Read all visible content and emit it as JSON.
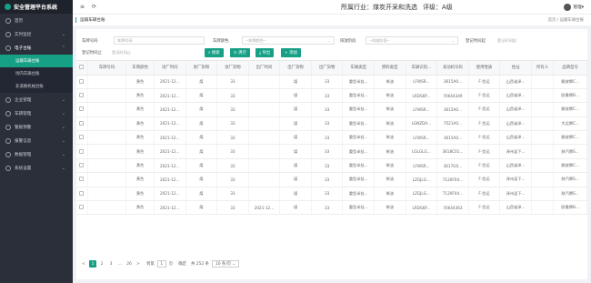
{
  "app": {
    "title": "安全管理平台系统"
  },
  "header": {
    "menu_icon": "≡",
    "refresh_icon": "⟳",
    "industry": "所属行业：煤炭开采和洗选",
    "level": "评级：A级",
    "user": "管理▾"
  },
  "sidebar": {
    "items": [
      {
        "label": "首页",
        "icon": "home-icon"
      },
      {
        "label": "实时监控",
        "icon": "monitor-icon"
      },
      {
        "label": "电子台账",
        "icon": "ledger-icon"
      },
      {
        "sub": [
          "运输车辆台账",
          "场内车辆台账",
          "非道路机械台账"
        ]
      },
      {
        "label": "企业管理",
        "icon": "company-icon"
      },
      {
        "label": "车辆管理",
        "icon": "car-icon"
      },
      {
        "label": "警报预警",
        "icon": "alarm-icon"
      },
      {
        "label": "报警信息",
        "icon": "bell-icon"
      },
      {
        "label": "数据管理",
        "icon": "data-icon"
      },
      {
        "label": "系统设置",
        "icon": "settings-icon"
      }
    ]
  },
  "tabbar": {
    "tab": "运输车辆台账",
    "crumb": "首页  /  运输车辆台账"
  },
  "filters": {
    "plate_label": "车牌号码",
    "plate_placeholder": "车牌号码",
    "color_label": "车牌颜色",
    "color_placeholder": "--车牌颜色--",
    "emission_label": "排放阶段",
    "emission_placeholder": "--排放阶段--",
    "start_label": "登记时间起",
    "start_placeholder": "登记时间起",
    "end_label": "登记时间止",
    "end_placeholder": "登记时间止"
  },
  "buttons": {
    "search": "搜索",
    "reset": "清空",
    "export": "导出",
    "add": "添加"
  },
  "table": {
    "headers": [
      "车牌号码",
      "车牌颜色",
      "进厂时间",
      "进厂货物",
      "进厂货物",
      "出厂时间",
      "出厂货物",
      "出厂货物",
      "车辆类型",
      "燃料类型",
      "车辆识别...",
      "发动机号码",
      "使用性质",
      "住址",
      "所有人",
      "品牌型号"
    ],
    "rows": [
      [
        "",
        "黄色",
        "2021-12...",
        "煤",
        "33",
        "",
        "煤",
        "33",
        "重型半挂...",
        "柴油",
        "LFWSR...",
        "3615A0...",
        "F-货运",
        "山西省泽...",
        "",
        "解放牌C..."
      ],
      [
        "",
        "黄色",
        "2021-12...",
        "煤",
        "33",
        "",
        "煤",
        "33",
        "重型半挂...",
        "柴油",
        "LRDS6P...",
        "70644349",
        "F-货运",
        "山西省泽...",
        "",
        "欧曼牌B..."
      ],
      [
        "",
        "黄色",
        "2021-12...",
        "煤",
        "33",
        "",
        "煤",
        "33",
        "重型半挂...",
        "柴油",
        "LFWSR...",
        "3615A0...",
        "F-货运",
        "山西省泽...",
        "",
        "解放牌C..."
      ],
      [
        "",
        "黄色",
        "2021-12...",
        "煤",
        "33",
        "",
        "煤",
        "33",
        "重型半挂...",
        "柴油",
        "LGNZDA...",
        "7521A0...",
        "F-货运",
        "山西省泽...",
        "",
        "大运牌C..."
      ],
      [
        "",
        "黄色",
        "2021-12...",
        "煤",
        "33",
        "",
        "煤",
        "33",
        "重型半挂...",
        "柴油",
        "LFWSR...",
        "3615A0...",
        "F-货运",
        "山西省泽...",
        "",
        "解放牌C..."
      ],
      [
        "",
        "黄色",
        "2021-12...",
        "煤",
        "33",
        "",
        "煤",
        "33",
        "重型半挂...",
        "柴油",
        "LGLGLG...",
        "3618C01...",
        "F-货运",
        "泽州县下...",
        "",
        "陕汽牌S..."
      ],
      [
        "",
        "黄色",
        "2021-12...",
        "煤",
        "33",
        "",
        "煤",
        "33",
        "重型半挂...",
        "柴油",
        "LFWSR...",
        "3617G0...",
        "F-货运",
        "山西省泽...",
        "",
        "解放牌C..."
      ],
      [
        "",
        "黄色",
        "2021-12...",
        "煤",
        "33",
        "",
        "煤",
        "33",
        "重型半挂...",
        "柴油",
        "LZGJLG...",
        "7120F04...",
        "F-货运",
        "泽州县下...",
        "",
        "陕汽牌S..."
      ],
      [
        "",
        "黄色",
        "2021-12...",
        "煤",
        "33",
        "",
        "煤",
        "33",
        "重型半挂...",
        "柴油",
        "LZGJLG...",
        "7120F04...",
        "F-货运",
        "泽州县下...",
        "",
        "陕汽牌S..."
      ],
      [
        "",
        "黄色",
        "2021-12...",
        "煤",
        "33",
        "2021-12...",
        "煤",
        "33",
        "重型半挂...",
        "柴油",
        "LRDS6P...",
        "70644363",
        "F-货运",
        "山西省泽...",
        "",
        "欧曼牌B..."
      ]
    ]
  },
  "pagination": {
    "prev": "<",
    "pages": [
      "1",
      "2",
      "3",
      "...",
      "26"
    ],
    "next": ">",
    "goto_label": "到第",
    "goto_value": "1",
    "goto_unit": "页",
    "confirm": "确定",
    "total": "共 252 条",
    "page_size": "10 条/页"
  },
  "colors": {
    "accent": "#16a085",
    "sidebar_bg": "#2b2f3a"
  }
}
